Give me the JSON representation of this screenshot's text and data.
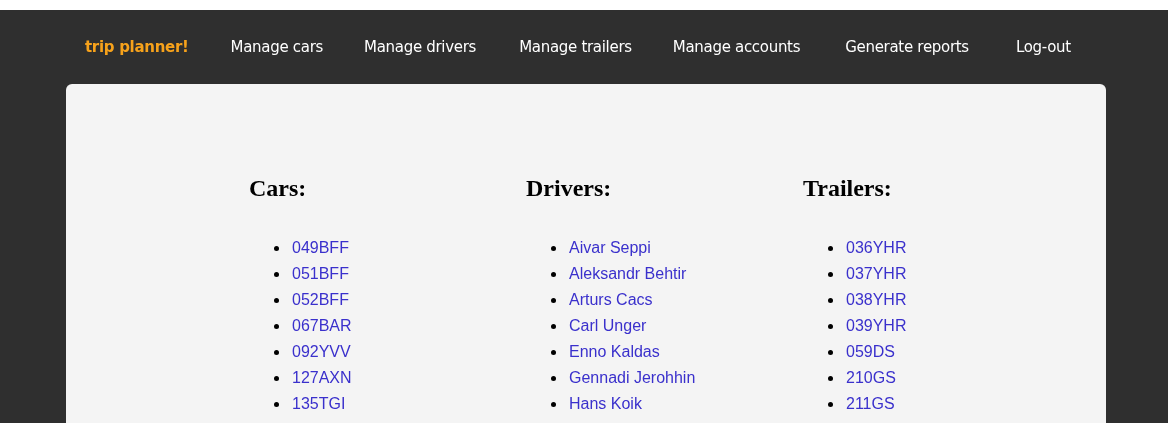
{
  "nav": {
    "brand": "trip planner!",
    "links": [
      "Manage cars",
      "Manage drivers",
      "Manage trailers",
      "Manage accounts",
      "Generate reports",
      "Log-out"
    ]
  },
  "columns": [
    {
      "heading": "Cars:",
      "items": [
        "049BFF",
        "051BFF",
        "052BFF",
        "067BAR",
        "092YVV",
        "127AXN",
        "135TGI"
      ]
    },
    {
      "heading": "Drivers:",
      "items": [
        "Aivar Seppi",
        "Aleksandr Behtir",
        "Arturs Cacs",
        "Carl Unger",
        "Enno Kaldas",
        "Gennadi Jerohhin",
        "Hans Koik"
      ]
    },
    {
      "heading": "Trailers:",
      "items": [
        "036YHR",
        "037YHR",
        "038YHR",
        "039YHR",
        "059DS",
        "210GS",
        "211GS"
      ]
    }
  ]
}
